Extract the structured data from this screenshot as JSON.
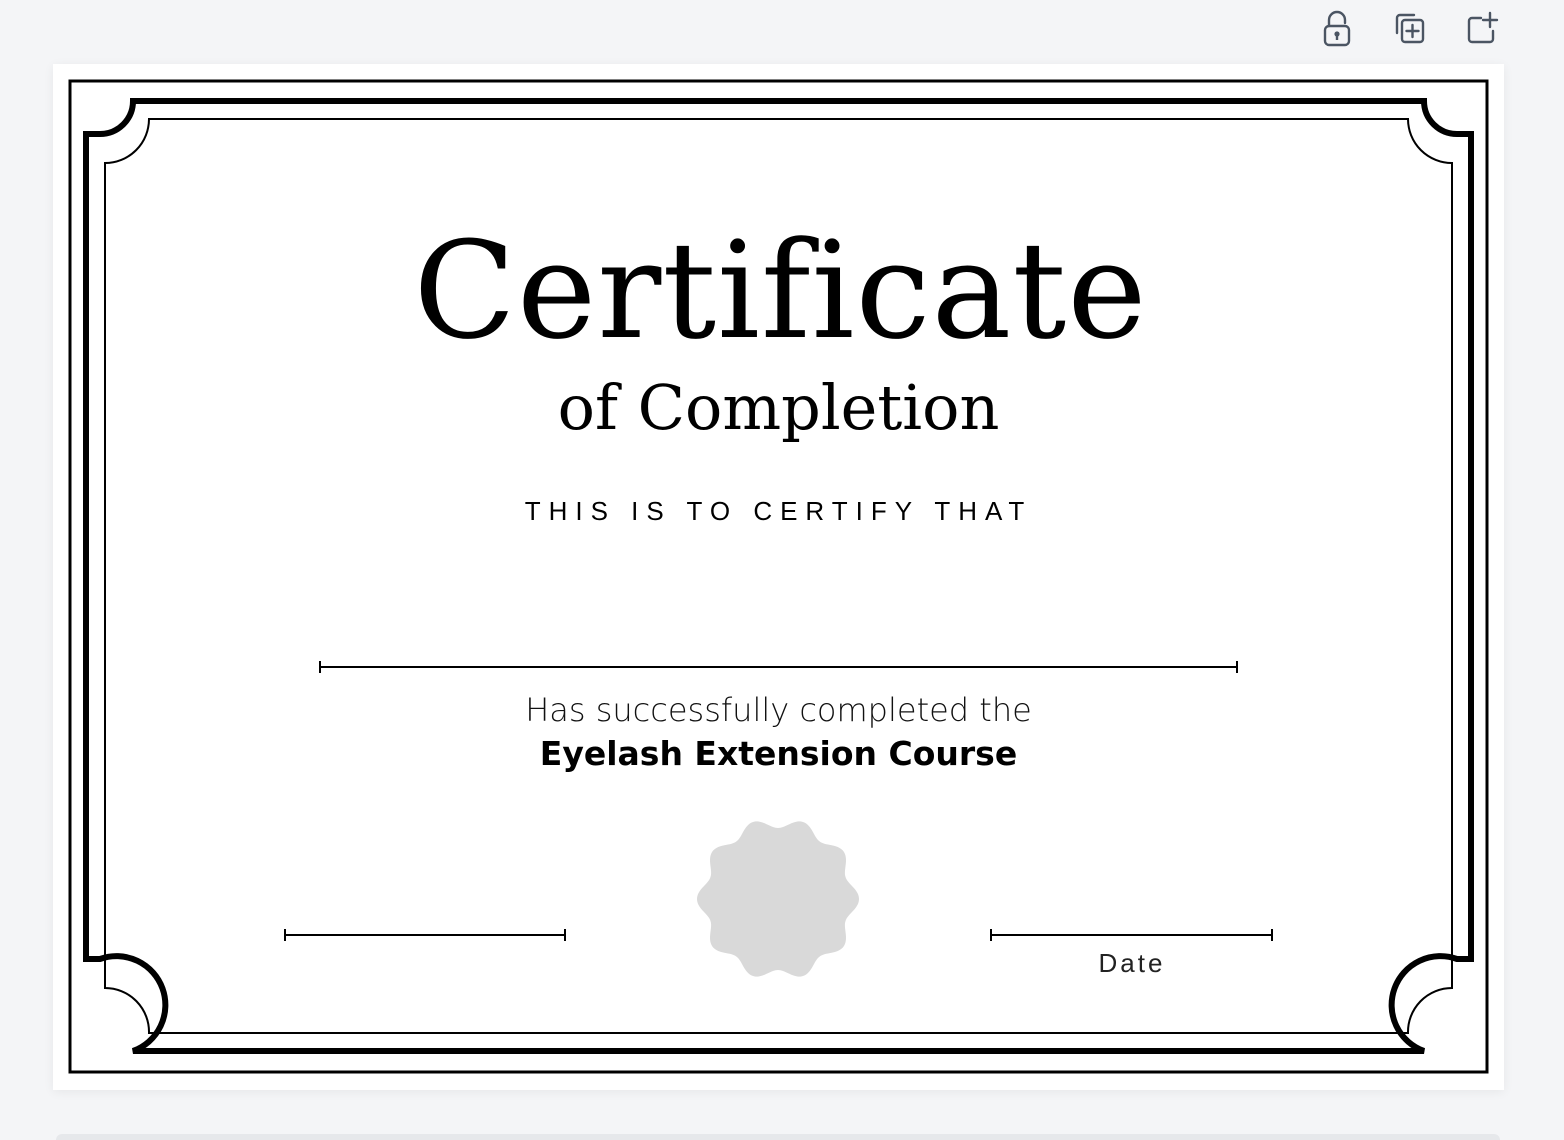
{
  "toolbar": {
    "buttons": [
      {
        "name": "unlock-button",
        "icon": "unlock-icon"
      },
      {
        "name": "duplicate-page-button",
        "icon": "duplicate-icon"
      },
      {
        "name": "add-page-button",
        "icon": "add-page-icon"
      }
    ]
  },
  "certificate": {
    "title": "Certificate",
    "subtitle": "of Completion",
    "certify_text": "THIS IS TO CERTIFY THAT",
    "completed_text": "Has successfully completed the",
    "course_name": "Eyelash Extension Course",
    "date_label": "Date",
    "seal_color": "#d9d9d9",
    "border_color": "#000000"
  }
}
